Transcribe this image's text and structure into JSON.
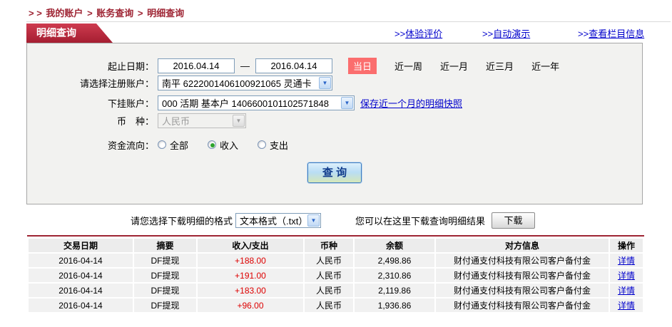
{
  "colors": {
    "tab_red": "#a51e31",
    "breadcrumb_red": "#9e2433",
    "today_badge_red": "#fb6e6e",
    "amount_red": "#dd0000",
    "link_blue": "#0000cc",
    "query_button_text": "#123d8c",
    "panel_bg": "#f2f2f0"
  },
  "breadcrumb": {
    "prefix": "> >",
    "items": [
      "我的账户",
      "账务查询",
      "明细查询"
    ],
    "separator": ">"
  },
  "tab_title": "明细查询",
  "top_links": [
    {
      "prefix": ">>",
      "label": "体验评价"
    },
    {
      "prefix": ">>",
      "label": "自动演示"
    },
    {
      "prefix": ">>",
      "label": "查看栏目信息"
    }
  ],
  "form": {
    "date_label": "起止日期：",
    "date_from": "2016.04.14",
    "date_separator": "—",
    "date_to": "2016.04.14",
    "today_badge": "当日",
    "quick_links": [
      "近一周",
      "近一月",
      "近三月",
      "近一年"
    ],
    "register_label": "请选择注册账户：",
    "register_value": "南平 6222001406100921065 灵通卡",
    "sub_label": "下挂账户：",
    "sub_value": "000 活期 基本户 1406600101102571848",
    "snapshot_link": "保存近一个月的明细快照",
    "currency_label": "币　种：",
    "currency_value": "人民币",
    "flow_label": "资金流向：",
    "flow_options": [
      {
        "label": "全部",
        "selected": false
      },
      {
        "label": "收入",
        "selected": true
      },
      {
        "label": "支出",
        "selected": false
      }
    ],
    "query_button": "查 询"
  },
  "download": {
    "format_label": "请您选择下载明细的格式",
    "format_value": "文本格式（.txt）",
    "hint": "您可以在这里下载查询明细结果",
    "button": "下载"
  },
  "table": {
    "headers": [
      "交易日期",
      "摘要",
      "收入/支出",
      "币种",
      "余额",
      "对方信息",
      "操作"
    ],
    "rows": [
      [
        "2016-04-14",
        "DF提现",
        "+188.00",
        "人民币",
        "2,498.86",
        "财付通支付科技有限公司客户备付金",
        "详情"
      ],
      [
        "2016-04-14",
        "DF提现",
        "+191.00",
        "人民币",
        "2,310.86",
        "财付通支付科技有限公司客户备付金",
        "详情"
      ],
      [
        "2016-04-14",
        "DF提现",
        "+183.00",
        "人民币",
        "2,119.86",
        "财付通支付科技有限公司客户备付金",
        "详情"
      ],
      [
        "2016-04-14",
        "DF提现",
        "+96.00",
        "人民币",
        "1,936.86",
        "财付通支付科技有限公司客户备付金",
        "详情"
      ]
    ]
  }
}
